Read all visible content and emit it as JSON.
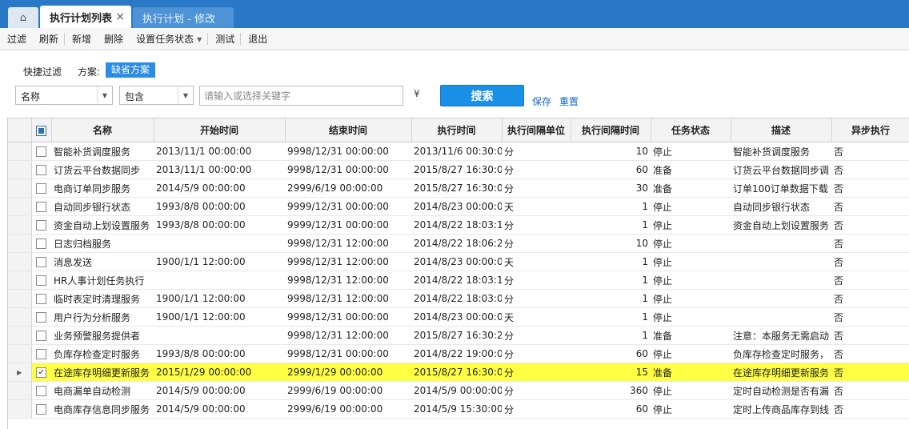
{
  "tabs": {
    "active_label": "执行计划列表",
    "inactive_label": "执行计划 - 修改",
    "close_glyph": "×"
  },
  "toolbar": {
    "filter": "过滤",
    "refresh": "刷新",
    "add": "新增",
    "delete": "删除",
    "set_status": "设置任务状态",
    "test": "测试",
    "exit": "退出"
  },
  "filter": {
    "quick_label": "快捷过滤",
    "plan_label": "方案:",
    "plan_value": "缺省方案",
    "field_value": "名称",
    "op_value": "包含",
    "keyword_placeholder": "请输入或选择关键字",
    "search_label": "搜索",
    "save_label": "保存",
    "reset_label": "重置"
  },
  "grid": {
    "columns": [
      "名称",
      "开始时间",
      "结束时间",
      "执行时间",
      "执行间隔单位",
      "执行间隔时间",
      "任务状态",
      "描述",
      "异步执行"
    ],
    "rows": [
      {
        "name": "智能补货调度服务",
        "start": "2013/11/1 00:00:00",
        "end": "9998/12/31 00:00:00",
        "exec": "2013/11/6 00:30:0",
        "unit": "分",
        "interval": "10",
        "status": "停止",
        "desc": "智能补货调度服务",
        "async": "否",
        "checked": false,
        "selected": false
      },
      {
        "name": "订货云平台数据同步",
        "start": "2013/11/1 00:00:00",
        "end": "9998/12/31 00:00:00",
        "exec": "2015/8/27 16:30:0",
        "unit": "分",
        "interval": "60",
        "status": "准备",
        "desc": "订货云平台数据同步调",
        "async": "否",
        "checked": false,
        "selected": false
      },
      {
        "name": "电商订单同步服务",
        "start": "2014/5/9 00:00:00",
        "end": "2999/6/19 00:00:00",
        "exec": "2015/8/27 16:30:0",
        "unit": "分",
        "interval": "30",
        "status": "准备",
        "desc": "订单100订单数据下载",
        "async": "否",
        "checked": false,
        "selected": false
      },
      {
        "name": "自动同步银行状态",
        "start": "1993/8/8 00:00:00",
        "end": "9999/12/31 00:00:00",
        "exec": "2014/8/23 00:00:0",
        "unit": "天",
        "interval": "1",
        "status": "停止",
        "desc": "自动同步银行状态",
        "async": "否",
        "checked": false,
        "selected": false
      },
      {
        "name": "资金自动上划设置服务",
        "start": "1993/8/8 00:00:00",
        "end": "9999/12/31 00:00:00",
        "exec": "2014/8/22 18:03:1",
        "unit": "分",
        "interval": "1",
        "status": "停止",
        "desc": "资金自动上划设置服务",
        "async": "否",
        "checked": false,
        "selected": false
      },
      {
        "name": "日志归档服务",
        "start": "",
        "end": "9998/12/31 12:00:00",
        "exec": "2014/8/22 18:06:2",
        "unit": "分",
        "interval": "10",
        "status": "停止",
        "desc": "",
        "async": "否",
        "checked": false,
        "selected": false
      },
      {
        "name": "消息发送",
        "start": "1900/1/1 12:00:00",
        "end": "9998/12/31 12:00:00",
        "exec": "2014/8/23 00:00:0",
        "unit": "天",
        "interval": "1",
        "status": "停止",
        "desc": "",
        "async": "否",
        "checked": false,
        "selected": false
      },
      {
        "name": "HR人事计划任务执行",
        "start": "",
        "end": "9998/12/31 12:00:00",
        "exec": "2014/8/22 18:03:1",
        "unit": "分",
        "interval": "1",
        "status": "停止",
        "desc": "",
        "async": "否",
        "checked": false,
        "selected": false
      },
      {
        "name": "临时表定时清理服务",
        "start": "1900/1/1 12:00:00",
        "end": "9998/12/31 12:00:00",
        "exec": "2014/8/22 18:03:0",
        "unit": "分",
        "interval": "1",
        "status": "停止",
        "desc": "",
        "async": "否",
        "checked": false,
        "selected": false
      },
      {
        "name": "用户行为分析服务",
        "start": "1900/1/1 12:00:00",
        "end": "9998/12/31 00:00:00",
        "exec": "2014/8/23 00:00:0",
        "unit": "天",
        "interval": "1",
        "status": "停止",
        "desc": "",
        "async": "否",
        "checked": false,
        "selected": false
      },
      {
        "name": "业务预警服务提供者",
        "start": "",
        "end": "9998/12/31 12:00:00",
        "exec": "2015/8/27 16:30:2",
        "unit": "分",
        "interval": "1",
        "status": "准备",
        "desc": "注意：本服务无需启动",
        "async": "否",
        "checked": false,
        "selected": false
      },
      {
        "name": "负库存检查定时服务",
        "start": "1993/8/8 00:00:00",
        "end": "9998/12/31 00:00:00",
        "exec": "2014/8/22 19:00:0",
        "unit": "分",
        "interval": "60",
        "status": "停止",
        "desc": "负库存检查定时服务，",
        "async": "否",
        "checked": false,
        "selected": false
      },
      {
        "name": "在途库存明细更新服务",
        "start": "2015/1/29 00:00:00",
        "end": "2999/1/29 00:00:00",
        "exec": "2015/8/27 16:30:0",
        "unit": "分",
        "interval": "15",
        "status": "准备",
        "desc": "在途库存明细更新服务",
        "async": "否",
        "checked": true,
        "selected": true
      },
      {
        "name": "电商漏单自动检测",
        "start": "2014/5/9 00:00:00",
        "end": "2999/6/19 00:00:00",
        "exec": "2014/5/9 00:00:00",
        "unit": "分",
        "interval": "360",
        "status": "停止",
        "desc": "定时自动检测是否有漏",
        "async": "否",
        "checked": false,
        "selected": false
      },
      {
        "name": "电商库存信息同步服务",
        "start": "2014/5/9 00:00:00",
        "end": "2999/6/19 00:00:00",
        "exec": "2014/5/9 15:30:00",
        "unit": "分",
        "interval": "60",
        "status": "停止",
        "desc": "定时上传商品库存到线",
        "async": "否",
        "checked": false,
        "selected": false
      }
    ]
  },
  "colors": {
    "tabbar": "#2a79c6",
    "accent": "#1a8fe6",
    "selected_row": "#ffff44",
    "link": "#1569c7"
  }
}
